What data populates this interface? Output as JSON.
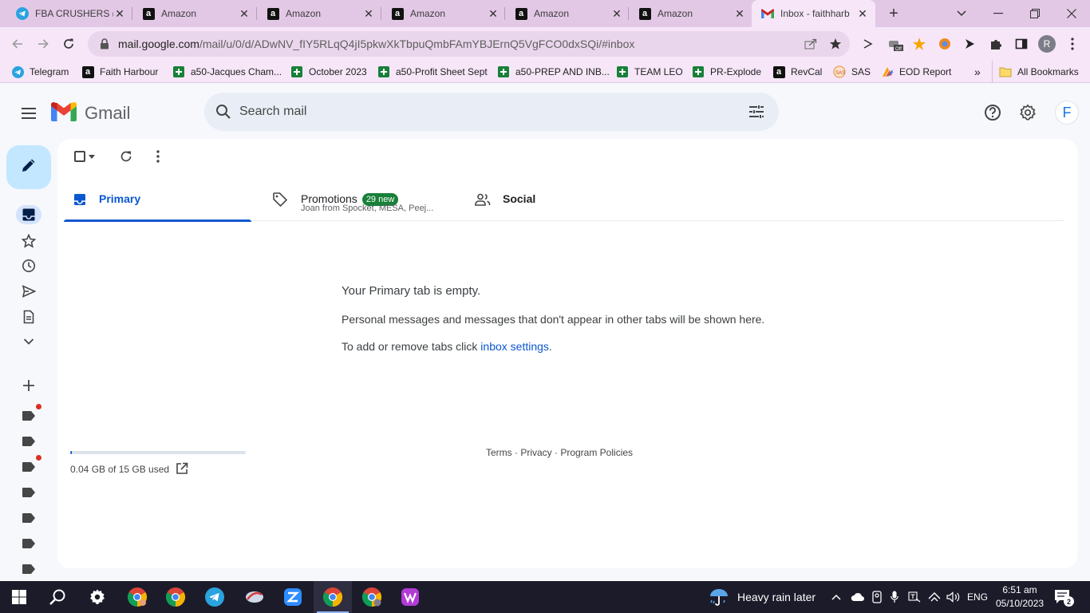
{
  "browser": {
    "tabs": [
      {
        "title": "FBA CRUSHERS (",
        "icon": "telegram-icon"
      },
      {
        "title": "Amazon",
        "icon": "amazon-icon"
      },
      {
        "title": "Amazon",
        "icon": "amazon-icon"
      },
      {
        "title": "Amazon",
        "icon": "amazon-icon"
      },
      {
        "title": "Amazon",
        "icon": "amazon-icon"
      },
      {
        "title": "Amazon",
        "icon": "amazon-icon"
      },
      {
        "title": "Inbox - faithharb",
        "icon": "gmail-icon",
        "active": true
      }
    ],
    "url_host": "mail.google.com",
    "url_path": "/mail/u/0/d/ADwNV_fIY5RLqQ4jI5pkwXkTbpuQmbFAmYBJErnQ5VgFCO0dxSQi/#inbox",
    "profile_initial": "R",
    "bookmarks": [
      {
        "label": "Telegram",
        "icon": "telegram-icon"
      },
      {
        "label": "Faith Harbour",
        "icon": "amazon-icon"
      },
      {
        "label": "a50-Jacques Cham...",
        "icon": "sheets-icon"
      },
      {
        "label": "October 2023",
        "icon": "sheets-icon"
      },
      {
        "label": "a50-Profit Sheet Sept",
        "icon": "sheets-icon"
      },
      {
        "label": "a50-PREP AND INB...",
        "icon": "sheets-icon"
      },
      {
        "label": "TEAM LEO",
        "icon": "sheets-icon"
      },
      {
        "label": "PR-Explode",
        "icon": "sheets-icon"
      },
      {
        "label": "RevCal",
        "icon": "amazon-icon"
      },
      {
        "label": "SAS",
        "icon": "sas-icon"
      },
      {
        "label": "EOD Report",
        "icon": "eod-icon"
      }
    ],
    "more_bookmarks": "»",
    "all_bookmarks": "All Bookmarks",
    "accent_color": "#e3c8e6"
  },
  "gmail": {
    "logo_text": "Gmail",
    "search_placeholder": "Search mail",
    "account_initial": "F",
    "category_tabs": {
      "primary": "Primary",
      "promotions": "Promotions",
      "promotions_badge": "29 new",
      "promotions_snippet": "Joan from Spocket, MESA, Peej...",
      "social": "Social"
    },
    "empty_state": {
      "heading": "Your Primary tab is empty.",
      "body": "Personal messages and messages that don't appear in other tabs will be shown here.",
      "settings_prefix": "To add or remove tabs click ",
      "settings_link": "inbox settings",
      "settings_suffix": "."
    },
    "storage": {
      "used_text": "0.04 GB of 15 GB used",
      "fraction": 0.003
    },
    "footer": "Terms · Privacy · Program Policies"
  },
  "taskbar": {
    "weather": "Heavy rain later",
    "language": "ENG",
    "time": "6:51 am",
    "date": "05/10/2023",
    "notifications": "2"
  }
}
